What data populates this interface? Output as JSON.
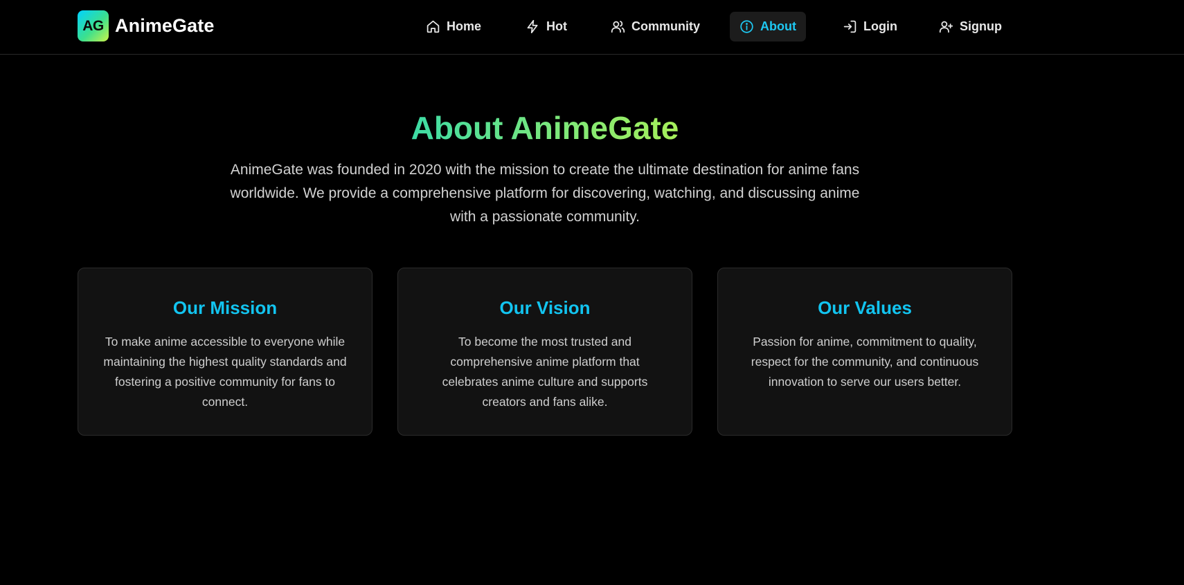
{
  "brand": {
    "logo_text": "AG",
    "name": "AnimeGate"
  },
  "nav": {
    "items": [
      {
        "label": "Home",
        "icon": "home-icon"
      },
      {
        "label": "Hot",
        "icon": "lightning-icon"
      },
      {
        "label": "Community",
        "icon": "users-icon"
      },
      {
        "label": "About",
        "icon": "info-icon",
        "active": true
      },
      {
        "label": "Login",
        "icon": "login-icon"
      },
      {
        "label": "Signup",
        "icon": "user-plus-icon"
      }
    ]
  },
  "hero": {
    "title": "About AnimeGate",
    "text": "AnimeGate was founded in 2020 with the mission to create the ultimate destination for anime fans worldwide. We provide a comprehensive platform for discovering, watching, and discussing anime with a passionate community."
  },
  "cards": [
    {
      "title": "Our Mission",
      "text": "To make anime accessible to everyone while maintaining the highest quality standards and fostering a positive community for fans to connect."
    },
    {
      "title": "Our Vision",
      "text": "To become the most trusted and comprehensive anime platform that celebrates anime culture and supports creators and fans alike."
    },
    {
      "title": "Our Values",
      "text": "Passion for anime, commitment to quality, respect for the community, and continuous innovation to serve our users better."
    }
  ],
  "colors": {
    "background": "#000000",
    "accent": "#12c4f0",
    "card_bg": "#121212",
    "card_border": "#2b2b2b",
    "nav_active_bg": "#1c1c1c",
    "title_gradient_start": "#3ddca6",
    "title_gradient_end": "#a6ef5a"
  }
}
